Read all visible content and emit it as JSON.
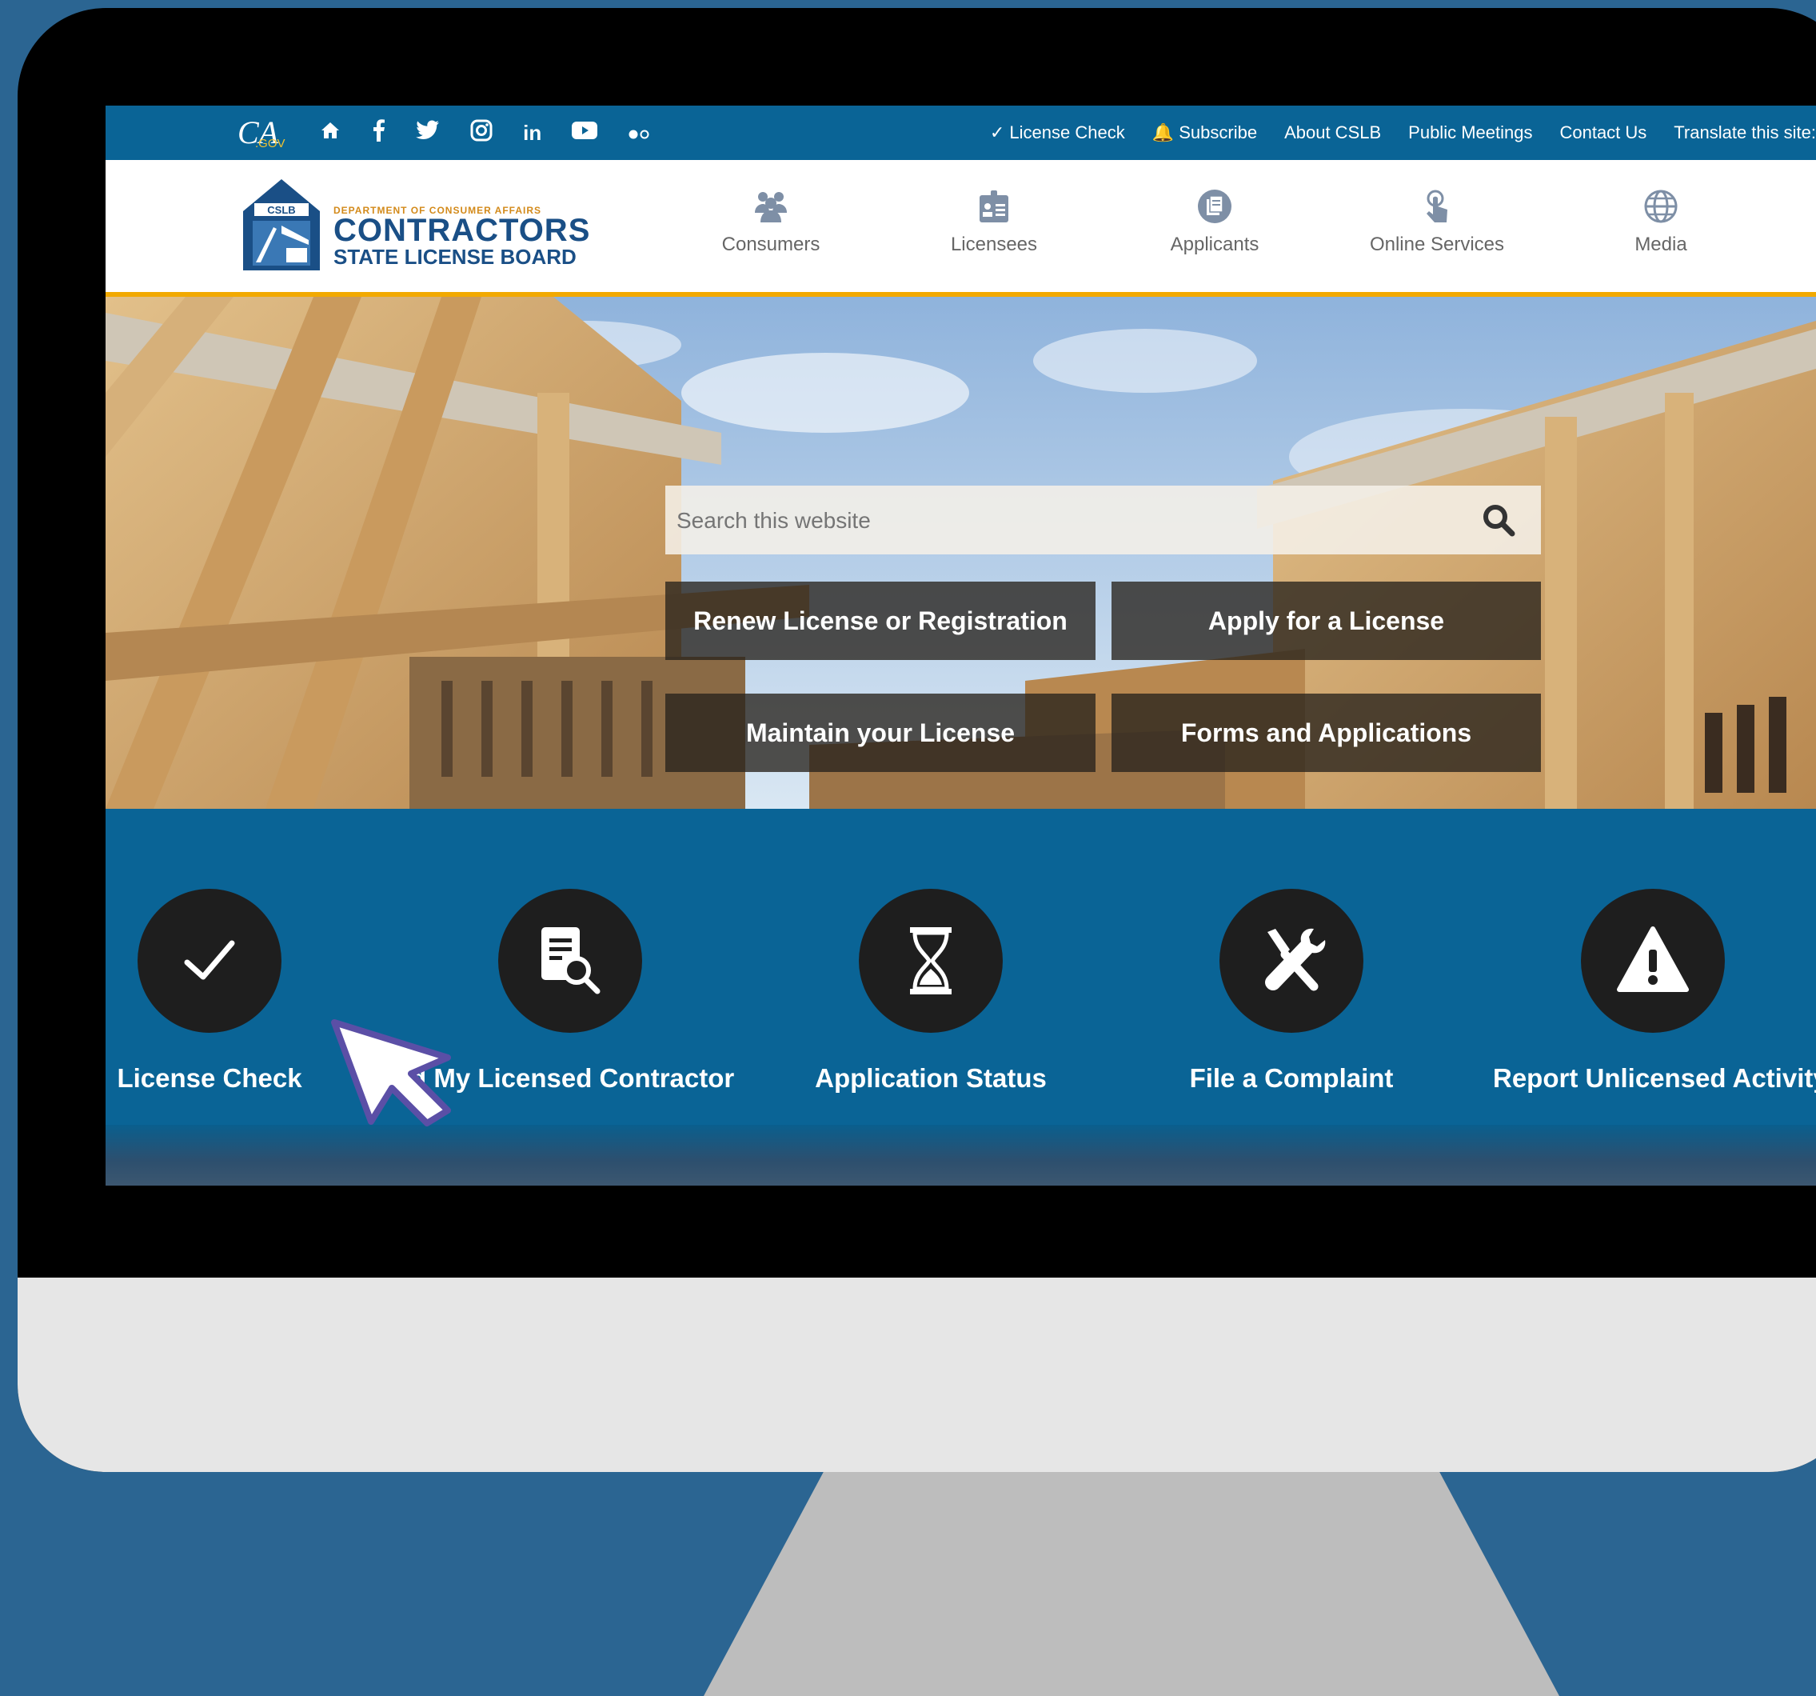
{
  "topbar": {
    "ca_logo": "CA",
    "ca_logo_suffix": ".GOV",
    "social_icons": [
      "home-icon",
      "facebook-icon",
      "twitter-icon",
      "instagram-icon",
      "linkedin-icon",
      "youtube-icon",
      "flickr-icon"
    ],
    "social_glyphs": {
      "linkedin": "in"
    },
    "links": [
      "✓ License Check",
      "🔔 Subscribe",
      "About CSLB",
      "Public Meetings",
      "Contact Us",
      "Translate this site:"
    ]
  },
  "brand": {
    "badge": "CSLB",
    "dept": "DEPARTMENT OF CONSUMER AFFAIRS",
    "name": "CONTRACTORS",
    "sub": "STATE LICENSE BOARD"
  },
  "nav": [
    {
      "label": "Consumers",
      "icon": "people-icon"
    },
    {
      "label": "Licensees",
      "icon": "id-card-icon"
    },
    {
      "label": "Applicants",
      "icon": "document-icon"
    },
    {
      "label": "Online Services",
      "icon": "touch-icon"
    },
    {
      "label": "Media",
      "icon": "globe-icon"
    }
  ],
  "hero": {
    "search_placeholder": "Search this website",
    "buttons": [
      "Renew License or Registration",
      "Apply for a License",
      "Maintain your License",
      "Forms and Applications"
    ]
  },
  "quick_links": [
    {
      "label": "License Check",
      "icon": "checkmark-icon"
    },
    {
      "label": "d My Licensed Contractor",
      "icon": "document-search-icon"
    },
    {
      "label": "Application Status",
      "icon": "hourglass-icon"
    },
    {
      "label": "File a Complaint",
      "icon": "tools-icon"
    },
    {
      "label": "Report Unlicensed Activity",
      "icon": "warning-icon"
    }
  ],
  "colors": {
    "background": "#2b6592",
    "site_blue": "#0a6496",
    "accent_gold": "#f2a900",
    "monitor_frame": "#000000",
    "monitor_chin": "#e6e6e6",
    "monitor_stand": "#bdbdbd"
  }
}
